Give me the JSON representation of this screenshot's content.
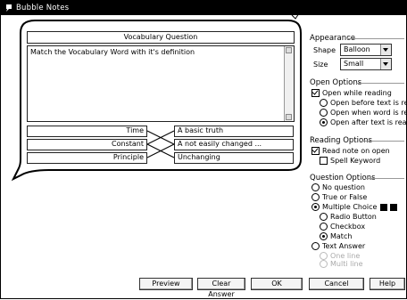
{
  "window": {
    "title": "Bubble Notes"
  },
  "question": {
    "title": "Vocabulary Question",
    "prompt": "Match the Vocabulary Word with it's definition",
    "match_left": [
      "Time",
      "Constant",
      "Principle"
    ],
    "match_right": [
      "A basic truth",
      "A not easily changed ...",
      "Unchanging"
    ]
  },
  "appearance": {
    "group_label": "Appearance",
    "shape_label": "Shape",
    "shape_value": "Balloon",
    "size_label": "Size",
    "size_value": "Small"
  },
  "open_options": {
    "group_label": "Open Options",
    "open_while_reading": "Open while reading",
    "before_text": "Open before text is read",
    "when_word": "Open when word is read",
    "after_text": "Open after text is read"
  },
  "reading_options": {
    "group_label": "Reading Options",
    "read_note_on_open": "Read note on open",
    "spell_keyword": "Spell Keyword"
  },
  "question_options": {
    "group_label": "Question Options",
    "no_question": "No question",
    "true_false": "True or False",
    "multiple_choice": "Multiple Choice",
    "radio_button": "Radio Button",
    "checkbox": "Checkbox",
    "match": "Match",
    "text_answer": "Text Answer",
    "one_line": "One line",
    "multi_line": "Multi line"
  },
  "buttons": {
    "preview": "Preview",
    "clear_answer": "Clear Answer",
    "ok": "OK",
    "cancel": "Cancel",
    "help": "Help"
  }
}
